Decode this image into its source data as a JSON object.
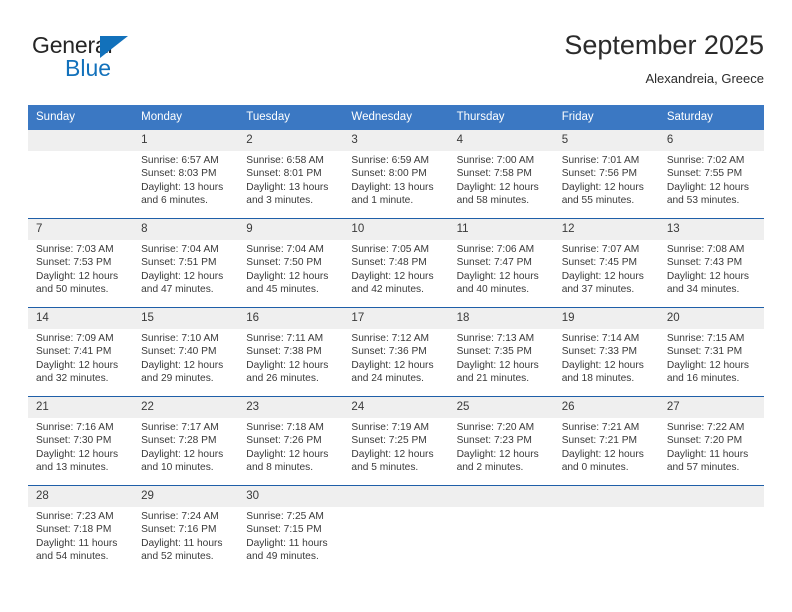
{
  "brand": {
    "name_top": "General",
    "name_bottom": "Blue",
    "triangle_color": "#1271bb"
  },
  "header": {
    "title": "September 2025",
    "subtitle": "Alexandreia, Greece"
  },
  "theme": {
    "header_blue": "#3b78c3",
    "row_divider_blue": "#1f5fa8",
    "daynum_band": "#efefef",
    "text": "#3a3a3a"
  },
  "weekdays": [
    "Sunday",
    "Monday",
    "Tuesday",
    "Wednesday",
    "Thursday",
    "Friday",
    "Saturday"
  ],
  "weeks": [
    [
      {
        "day": "",
        "sunrise": "",
        "sunset": "",
        "daylight1": "",
        "daylight2": "",
        "empty": true
      },
      {
        "day": "1",
        "sunrise": "Sunrise: 6:57 AM",
        "sunset": "Sunset: 8:03 PM",
        "daylight1": "Daylight: 13 hours",
        "daylight2": "and 6 minutes."
      },
      {
        "day": "2",
        "sunrise": "Sunrise: 6:58 AM",
        "sunset": "Sunset: 8:01 PM",
        "daylight1": "Daylight: 13 hours",
        "daylight2": "and 3 minutes."
      },
      {
        "day": "3",
        "sunrise": "Sunrise: 6:59 AM",
        "sunset": "Sunset: 8:00 PM",
        "daylight1": "Daylight: 13 hours",
        "daylight2": "and 1 minute."
      },
      {
        "day": "4",
        "sunrise": "Sunrise: 7:00 AM",
        "sunset": "Sunset: 7:58 PM",
        "daylight1": "Daylight: 12 hours",
        "daylight2": "and 58 minutes."
      },
      {
        "day": "5",
        "sunrise": "Sunrise: 7:01 AM",
        "sunset": "Sunset: 7:56 PM",
        "daylight1": "Daylight: 12 hours",
        "daylight2": "and 55 minutes."
      },
      {
        "day": "6",
        "sunrise": "Sunrise: 7:02 AM",
        "sunset": "Sunset: 7:55 PM",
        "daylight1": "Daylight: 12 hours",
        "daylight2": "and 53 minutes."
      }
    ],
    [
      {
        "day": "7",
        "sunrise": "Sunrise: 7:03 AM",
        "sunset": "Sunset: 7:53 PM",
        "daylight1": "Daylight: 12 hours",
        "daylight2": "and 50 minutes."
      },
      {
        "day": "8",
        "sunrise": "Sunrise: 7:04 AM",
        "sunset": "Sunset: 7:51 PM",
        "daylight1": "Daylight: 12 hours",
        "daylight2": "and 47 minutes."
      },
      {
        "day": "9",
        "sunrise": "Sunrise: 7:04 AM",
        "sunset": "Sunset: 7:50 PM",
        "daylight1": "Daylight: 12 hours",
        "daylight2": "and 45 minutes."
      },
      {
        "day": "10",
        "sunrise": "Sunrise: 7:05 AM",
        "sunset": "Sunset: 7:48 PM",
        "daylight1": "Daylight: 12 hours",
        "daylight2": "and 42 minutes."
      },
      {
        "day": "11",
        "sunrise": "Sunrise: 7:06 AM",
        "sunset": "Sunset: 7:47 PM",
        "daylight1": "Daylight: 12 hours",
        "daylight2": "and 40 minutes."
      },
      {
        "day": "12",
        "sunrise": "Sunrise: 7:07 AM",
        "sunset": "Sunset: 7:45 PM",
        "daylight1": "Daylight: 12 hours",
        "daylight2": "and 37 minutes."
      },
      {
        "day": "13",
        "sunrise": "Sunrise: 7:08 AM",
        "sunset": "Sunset: 7:43 PM",
        "daylight1": "Daylight: 12 hours",
        "daylight2": "and 34 minutes."
      }
    ],
    [
      {
        "day": "14",
        "sunrise": "Sunrise: 7:09 AM",
        "sunset": "Sunset: 7:41 PM",
        "daylight1": "Daylight: 12 hours",
        "daylight2": "and 32 minutes."
      },
      {
        "day": "15",
        "sunrise": "Sunrise: 7:10 AM",
        "sunset": "Sunset: 7:40 PM",
        "daylight1": "Daylight: 12 hours",
        "daylight2": "and 29 minutes."
      },
      {
        "day": "16",
        "sunrise": "Sunrise: 7:11 AM",
        "sunset": "Sunset: 7:38 PM",
        "daylight1": "Daylight: 12 hours",
        "daylight2": "and 26 minutes."
      },
      {
        "day": "17",
        "sunrise": "Sunrise: 7:12 AM",
        "sunset": "Sunset: 7:36 PM",
        "daylight1": "Daylight: 12 hours",
        "daylight2": "and 24 minutes."
      },
      {
        "day": "18",
        "sunrise": "Sunrise: 7:13 AM",
        "sunset": "Sunset: 7:35 PM",
        "daylight1": "Daylight: 12 hours",
        "daylight2": "and 21 minutes."
      },
      {
        "day": "19",
        "sunrise": "Sunrise: 7:14 AM",
        "sunset": "Sunset: 7:33 PM",
        "daylight1": "Daylight: 12 hours",
        "daylight2": "and 18 minutes."
      },
      {
        "day": "20",
        "sunrise": "Sunrise: 7:15 AM",
        "sunset": "Sunset: 7:31 PM",
        "daylight1": "Daylight: 12 hours",
        "daylight2": "and 16 minutes."
      }
    ],
    [
      {
        "day": "21",
        "sunrise": "Sunrise: 7:16 AM",
        "sunset": "Sunset: 7:30 PM",
        "daylight1": "Daylight: 12 hours",
        "daylight2": "and 13 minutes."
      },
      {
        "day": "22",
        "sunrise": "Sunrise: 7:17 AM",
        "sunset": "Sunset: 7:28 PM",
        "daylight1": "Daylight: 12 hours",
        "daylight2": "and 10 minutes."
      },
      {
        "day": "23",
        "sunrise": "Sunrise: 7:18 AM",
        "sunset": "Sunset: 7:26 PM",
        "daylight1": "Daylight: 12 hours",
        "daylight2": "and 8 minutes."
      },
      {
        "day": "24",
        "sunrise": "Sunrise: 7:19 AM",
        "sunset": "Sunset: 7:25 PM",
        "daylight1": "Daylight: 12 hours",
        "daylight2": "and 5 minutes."
      },
      {
        "day": "25",
        "sunrise": "Sunrise: 7:20 AM",
        "sunset": "Sunset: 7:23 PM",
        "daylight1": "Daylight: 12 hours",
        "daylight2": "and 2 minutes."
      },
      {
        "day": "26",
        "sunrise": "Sunrise: 7:21 AM",
        "sunset": "Sunset: 7:21 PM",
        "daylight1": "Daylight: 12 hours",
        "daylight2": "and 0 minutes."
      },
      {
        "day": "27",
        "sunrise": "Sunrise: 7:22 AM",
        "sunset": "Sunset: 7:20 PM",
        "daylight1": "Daylight: 11 hours",
        "daylight2": "and 57 minutes."
      }
    ],
    [
      {
        "day": "28",
        "sunrise": "Sunrise: 7:23 AM",
        "sunset": "Sunset: 7:18 PM",
        "daylight1": "Daylight: 11 hours",
        "daylight2": "and 54 minutes."
      },
      {
        "day": "29",
        "sunrise": "Sunrise: 7:24 AM",
        "sunset": "Sunset: 7:16 PM",
        "daylight1": "Daylight: 11 hours",
        "daylight2": "and 52 minutes."
      },
      {
        "day": "30",
        "sunrise": "Sunrise: 7:25 AM",
        "sunset": "Sunset: 7:15 PM",
        "daylight1": "Daylight: 11 hours",
        "daylight2": "and 49 minutes."
      },
      {
        "day": "",
        "sunrise": "",
        "sunset": "",
        "daylight1": "",
        "daylight2": "",
        "empty": true
      },
      {
        "day": "",
        "sunrise": "",
        "sunset": "",
        "daylight1": "",
        "daylight2": "",
        "empty": true
      },
      {
        "day": "",
        "sunrise": "",
        "sunset": "",
        "daylight1": "",
        "daylight2": "",
        "empty": true
      },
      {
        "day": "",
        "sunrise": "",
        "sunset": "",
        "daylight1": "",
        "daylight2": "",
        "empty": true
      }
    ]
  ]
}
